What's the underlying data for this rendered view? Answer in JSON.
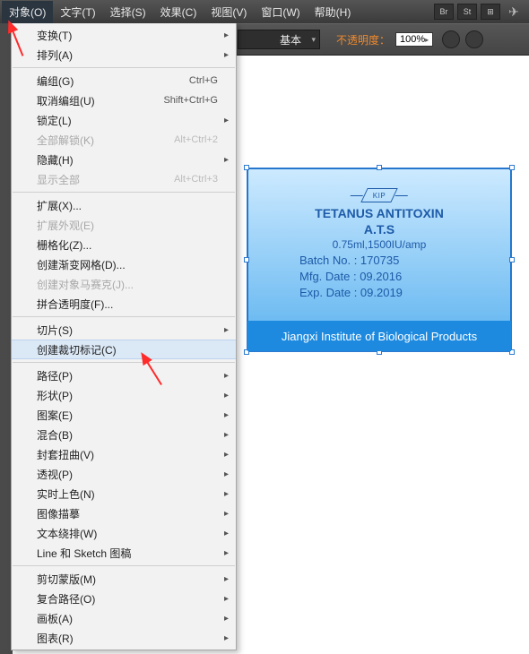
{
  "menubar": {
    "items": [
      {
        "label": "对象(O)",
        "active": true
      },
      {
        "label": "文字(T)"
      },
      {
        "label": "选择(S)"
      },
      {
        "label": "效果(C)"
      },
      {
        "label": "视图(V)"
      },
      {
        "label": "窗口(W)"
      },
      {
        "label": "帮助(H)"
      }
    ],
    "right_icons": [
      "Br",
      "St",
      "⊞",
      "✈"
    ]
  },
  "toolbar": {
    "style_dropdown": "基本",
    "opacity_label": "不透明度：",
    "opacity_value": "100%"
  },
  "dropdown": {
    "items": [
      {
        "label": "变换(T)",
        "sub": true
      },
      {
        "label": "排列(A)",
        "sub": true
      },
      "sep",
      {
        "label": "编组(G)",
        "shortcut": "Ctrl+G"
      },
      {
        "label": "取消编组(U)",
        "shortcut": "Shift+Ctrl+G"
      },
      {
        "label": "锁定(L)",
        "sub": true
      },
      {
        "label": "全部解锁(K)",
        "shortcut": "Alt+Ctrl+2",
        "disabled": true
      },
      {
        "label": "隐藏(H)",
        "sub": true
      },
      {
        "label": "显示全部",
        "shortcut": "Alt+Ctrl+3",
        "disabled": true
      },
      "sep",
      {
        "label": "扩展(X)..."
      },
      {
        "label": "扩展外观(E)",
        "disabled": true
      },
      {
        "label": "栅格化(Z)..."
      },
      {
        "label": "创建渐变网格(D)..."
      },
      {
        "label": "创建对象马赛克(J)...",
        "disabled": true
      },
      {
        "label": "拼合透明度(F)..."
      },
      "sep",
      {
        "label": "切片(S)",
        "sub": true
      },
      {
        "label": "创建裁切标记(C)",
        "highlight": true
      },
      "sep",
      {
        "label": "路径(P)",
        "sub": true
      },
      {
        "label": "形状(P)",
        "sub": true
      },
      {
        "label": "图案(E)",
        "sub": true
      },
      {
        "label": "混合(B)",
        "sub": true
      },
      {
        "label": "封套扭曲(V)",
        "sub": true
      },
      {
        "label": "透视(P)",
        "sub": true
      },
      {
        "label": "实时上色(N)",
        "sub": true
      },
      {
        "label": "图像描摹",
        "sub": true
      },
      {
        "label": "文本绕排(W)",
        "sub": true
      },
      {
        "label": "Line 和 Sketch 图稿",
        "sub": true
      },
      "sep",
      {
        "label": "剪切蒙版(M)",
        "sub": true
      },
      {
        "label": "复合路径(O)",
        "sub": true
      },
      {
        "label": "画板(A)",
        "sub": true
      },
      {
        "label": "图表(R)",
        "sub": true
      }
    ]
  },
  "document": {
    "logo_text": "KIP",
    "title": "TETANUS ANTITOXIN",
    "ats": "A.T.S",
    "dose": "0.75ml,1500IU/amp",
    "batch": "Batch No. : 170735",
    "mfg": "Mfg. Date : 09.2016",
    "exp": "Exp. Date : 09.2019",
    "footer": "Jiangxi Institute of Biological Products"
  }
}
